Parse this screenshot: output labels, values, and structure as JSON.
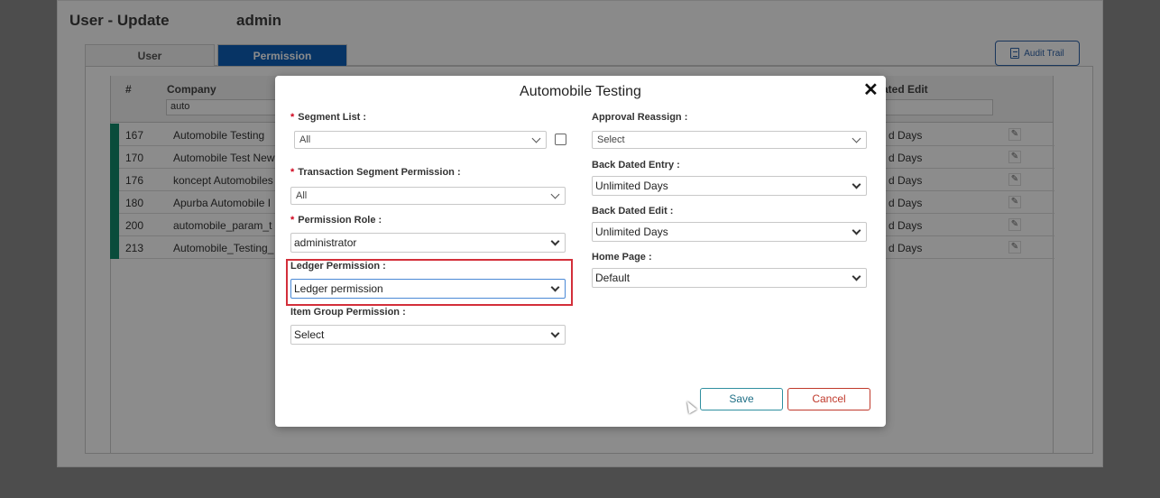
{
  "page": {
    "title": "User - Update",
    "user": "admin",
    "tabs": [
      {
        "label": "User"
      },
      {
        "label": "Permission"
      }
    ],
    "audit_trail_label": "Audit Trail",
    "grid": {
      "headers": {
        "id": "#",
        "company": "Company",
        "back_dated_edit": "ated Edit"
      },
      "company_filter": "auto",
      "rows": [
        {
          "id": "167",
          "company": "Automobile Testing",
          "back_dated_edit": "d Days"
        },
        {
          "id": "170",
          "company": "Automobile Test New",
          "back_dated_edit": "d Days"
        },
        {
          "id": "176",
          "company": "koncept Automobiles",
          "back_dated_edit": "d Days"
        },
        {
          "id": "180",
          "company": "Apurba Automobile I",
          "back_dated_edit": "d Days"
        },
        {
          "id": "200",
          "company": "automobile_param_t",
          "back_dated_edit": "d Days"
        },
        {
          "id": "213",
          "company": "Automobile_Testing_",
          "back_dated_edit": "d Days"
        }
      ]
    }
  },
  "modal": {
    "title": "Automobile Testing",
    "close_glyph": "✕",
    "fields": {
      "segment_list": {
        "label": "Segment List :",
        "value": "All",
        "required": true
      },
      "transaction_segment_permission": {
        "label": "Transaction Segment Permission :",
        "value": "All",
        "required": true
      },
      "permission_role": {
        "label": "Permission Role :",
        "value": "administrator",
        "required": true
      },
      "ledger_permission": {
        "label": "Ledger Permission :",
        "value": "Ledger permission"
      },
      "item_group_permission": {
        "label": "Item Group Permission :",
        "value": "Select"
      },
      "approval_reassign": {
        "label": "Approval Reassign :",
        "value": "Select"
      },
      "back_dated_entry": {
        "label": "Back Dated Entry :",
        "value": "Unlimited Days"
      },
      "back_dated_edit": {
        "label": "Back Dated Edit :",
        "value": "Unlimited Days"
      },
      "home_page": {
        "label": "Home Page :",
        "value": "Default"
      }
    },
    "required_marker": "*",
    "save_label": "Save",
    "cancel_label": "Cancel"
  },
  "colors": {
    "tab_active": "#0d5fb8",
    "row_status": "#128a6c",
    "highlight": "#d32f3a",
    "save_border": "#2f8fa0",
    "cancel_border": "#c0392b"
  }
}
